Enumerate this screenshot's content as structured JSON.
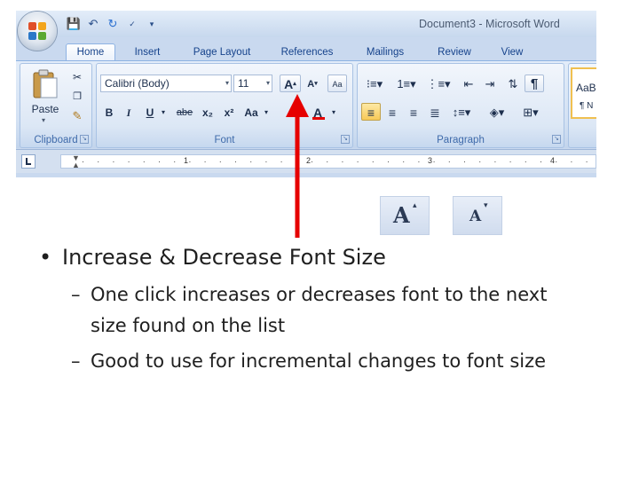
{
  "window": {
    "title": "Document3 - Microsoft Word"
  },
  "tabs": [
    {
      "label": "Home",
      "active": true
    },
    {
      "label": "Insert"
    },
    {
      "label": "Page Layout"
    },
    {
      "label": "References"
    },
    {
      "label": "Mailings"
    },
    {
      "label": "Review"
    },
    {
      "label": "View"
    }
  ],
  "clipboard": {
    "paste_label": "Paste",
    "group_label": "Clipboard"
  },
  "font": {
    "font_name": "Calibri (Body)",
    "font_size": "11",
    "grow_font_label": "A",
    "shrink_font_label": "A",
    "bold_label": "B",
    "italic_label": "I",
    "underline_label": "U",
    "strike_label": "abe",
    "subscript_label": "x₂",
    "superscript_label": "x²",
    "change_case_label": "Aa",
    "font_color_label": "A",
    "group_label": "Font"
  },
  "paragraph": {
    "group_label": "Paragraph",
    "pilcrow": "¶"
  },
  "styles": {
    "preview_top": "AaB",
    "preview_bottom": "¶ N"
  },
  "ruler": {
    "numbers": [
      "1",
      "2",
      "3",
      "4"
    ]
  },
  "bullets": {
    "main": "Increase & Decrease Font Size",
    "sub1_line1": "One click increases or decreases font to the next",
    "sub1_line2": "size found on the list",
    "sub2": "Good to use for incremental changes to font size",
    "main_marker": "•",
    "sub_marker": "–"
  },
  "colors": {
    "arrow": "#e60000",
    "ribbon_text": "#15428b",
    "font_color_bar": "#e60000"
  }
}
